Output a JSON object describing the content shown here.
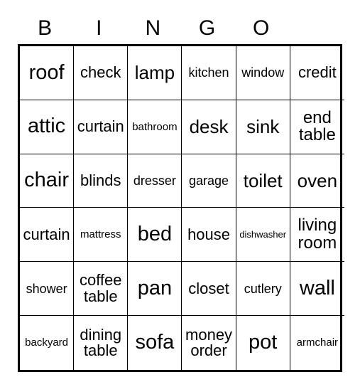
{
  "card": {
    "title": "BINGO",
    "columns": 6,
    "rows": 6,
    "header_letters": [
      "B",
      "I",
      "N",
      "G",
      "O",
      ""
    ],
    "colors": {
      "background": "#ffffff",
      "text": "#000000",
      "border": "#000000"
    },
    "cells": [
      {
        "text": "roof",
        "size": "fs-xl"
      },
      {
        "text": "check",
        "size": "fs-md"
      },
      {
        "text": "lamp",
        "size": "fs-lg"
      },
      {
        "text": "kitchen",
        "size": "fs-sm"
      },
      {
        "text": "window",
        "size": "fs-sm"
      },
      {
        "text": "credit",
        "size": "fs-md"
      },
      {
        "text": "attic",
        "size": "fs-xl"
      },
      {
        "text": "curtain",
        "size": "fs-md"
      },
      {
        "text": "bathroom",
        "size": "fs-xs"
      },
      {
        "text": "desk",
        "size": "fs-lg"
      },
      {
        "text": "sink",
        "size": "fs-lg"
      },
      {
        "text": "end\ntable",
        "size": "fs-two"
      },
      {
        "text": "chair",
        "size": "fs-xl"
      },
      {
        "text": "blinds",
        "size": "fs-md"
      },
      {
        "text": "dresser",
        "size": "fs-sm"
      },
      {
        "text": "garage",
        "size": "fs-sm"
      },
      {
        "text": "toilet",
        "size": "fs-lg"
      },
      {
        "text": "oven",
        "size": "fs-lg"
      },
      {
        "text": "curtain",
        "size": "fs-md"
      },
      {
        "text": "mattress",
        "size": "fs-xs"
      },
      {
        "text": "bed",
        "size": "fs-xl"
      },
      {
        "text": "house",
        "size": "fs-md"
      },
      {
        "text": "dishwasher",
        "size": "fs-xxs"
      },
      {
        "text": "living\nroom",
        "size": "fs-two"
      },
      {
        "text": "shower",
        "size": "fs-sm"
      },
      {
        "text": "coffee\ntable",
        "size": "fs-two-sm"
      },
      {
        "text": "pan",
        "size": "fs-xl"
      },
      {
        "text": "closet",
        "size": "fs-md"
      },
      {
        "text": "cutlery",
        "size": "fs-sm"
      },
      {
        "text": "wall",
        "size": "fs-xl"
      },
      {
        "text": "backyard",
        "size": "fs-xs"
      },
      {
        "text": "dining\ntable",
        "size": "fs-two-sm"
      },
      {
        "text": "sofa",
        "size": "fs-xl"
      },
      {
        "text": "money\norder",
        "size": "fs-two-sm"
      },
      {
        "text": "pot",
        "size": "fs-xl"
      },
      {
        "text": "armchair",
        "size": "fs-xs"
      }
    ]
  }
}
